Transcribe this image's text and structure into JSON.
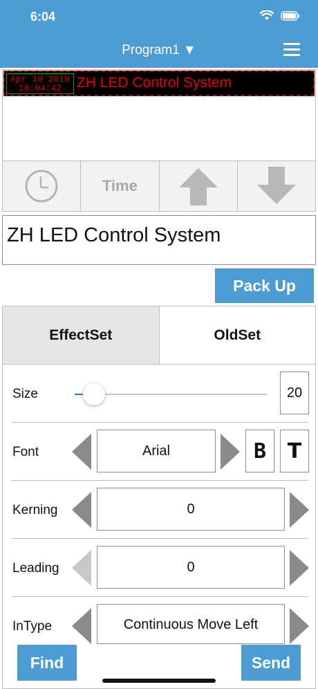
{
  "status_bar": {
    "time": "6:04"
  },
  "header": {
    "title": "Program1 ▼",
    "menu_icon": "hamburger-menu-icon"
  },
  "preview": {
    "date_line1": "Apr 10 2019",
    "date_line2": "18:04:42",
    "led_text": "ZH LED Control System",
    "led_text_color": "#e60000",
    "led_bg_color": "#000000"
  },
  "tools": {
    "clock_icon": "clock-icon",
    "time_label": "Time",
    "up_icon": "arrow-up-icon",
    "down_icon": "arrow-down-icon"
  },
  "text_input": {
    "value": "ZH LED Control System"
  },
  "pack_up_label": "Pack Up",
  "tabs": {
    "effect_set": "EffectSet",
    "old_set": "OldSet"
  },
  "settings": {
    "size": {
      "label": "Size",
      "value": "20",
      "slider_fraction": 0.1
    },
    "font": {
      "label": "Font",
      "value": "Arial",
      "bold_label": "B",
      "t_label": "T"
    },
    "kerning": {
      "label": "Kerning",
      "value": "0"
    },
    "leading": {
      "label": "Leading",
      "value": "0"
    },
    "intype": {
      "label": "InType",
      "value": "Continuous Move Left"
    }
  },
  "find_label": "Find",
  "send_label": "Send",
  "colors": {
    "accent": "#4b9cd3",
    "slider_fill": "#1a7bff"
  }
}
